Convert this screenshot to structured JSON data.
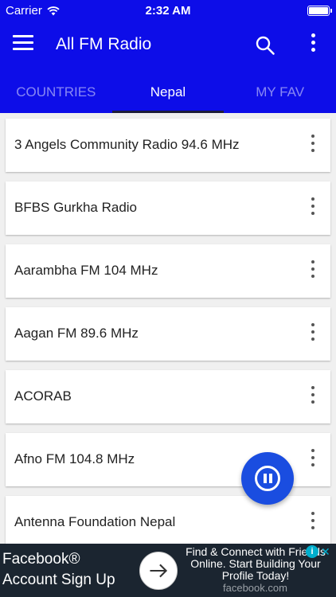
{
  "status_bar": {
    "carrier": "Carrier",
    "time": "2:32 AM"
  },
  "app": {
    "title": "All FM Radio",
    "menu_icon": "hamburger-menu-icon",
    "search_icon": "search-icon",
    "more_icon": "more-vert-icon"
  },
  "tabs": [
    {
      "label": "COUNTRIES",
      "active": false
    },
    {
      "label": "Nepal",
      "active": true
    },
    {
      "label": "MY FAV",
      "active": false
    }
  ],
  "stations": [
    {
      "name": "3 Angels Community Radio 94.6 MHz"
    },
    {
      "name": "BFBS Gurkha Radio"
    },
    {
      "name": "Aarambha FM 104 MHz"
    },
    {
      "name": "Aagan FM 89.6 MHz"
    },
    {
      "name": "ACORAB"
    },
    {
      "name": "Afno FM 104.8 MHz"
    },
    {
      "name": "Antenna Foundation Nepal"
    }
  ],
  "player": {
    "state": "playing",
    "button_icon": "pause-circle-icon"
  },
  "ad": {
    "brand_line1": "Facebook®",
    "brand_line2": "Account Sign Up",
    "text": "Find & Connect with Friends Online. Start Building Your Profile Today!",
    "domain": "facebook.com",
    "info_label": "i",
    "close_label": "✕"
  },
  "colors": {
    "primary": "#0d0de8",
    "fab": "#1a4de0",
    "ad_background": "#1b2530"
  }
}
